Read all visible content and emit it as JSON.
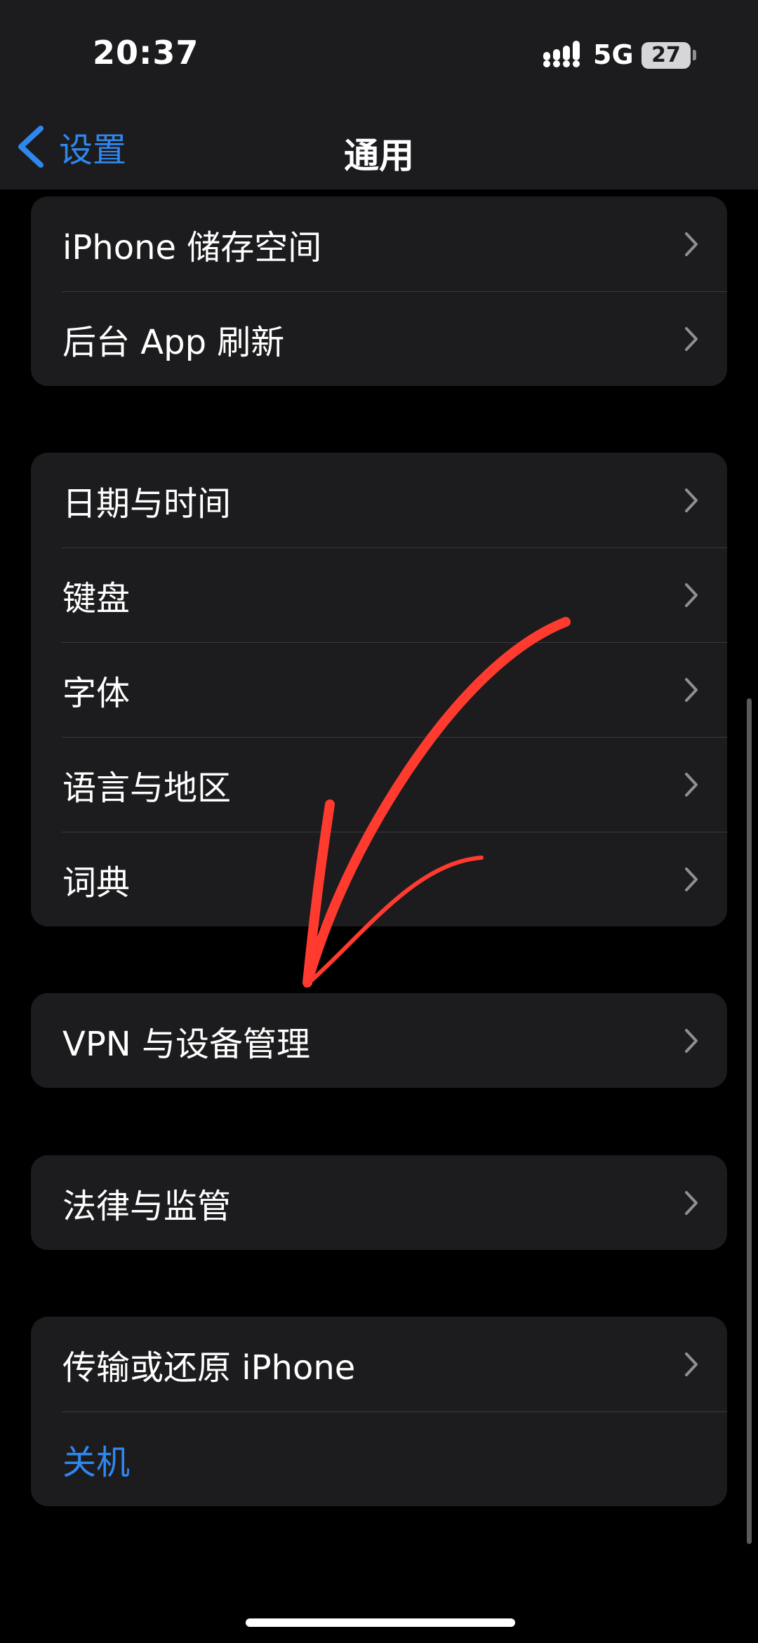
{
  "status_bar": {
    "time": "20:37",
    "network": "5G",
    "battery": "27"
  },
  "nav": {
    "back_label": "设置",
    "title": "通用"
  },
  "groups": [
    {
      "items": [
        {
          "label": "iPhone 储存空间"
        },
        {
          "label": "后台 App 刷新"
        }
      ]
    },
    {
      "items": [
        {
          "label": "日期与时间"
        },
        {
          "label": "键盘"
        },
        {
          "label": "字体"
        },
        {
          "label": "语言与地区"
        },
        {
          "label": "词典"
        }
      ]
    },
    {
      "items": [
        {
          "label": "VPN 与设备管理"
        }
      ]
    },
    {
      "items": [
        {
          "label": "法律与监管"
        }
      ]
    },
    {
      "items": [
        {
          "label": "传输或还原 iPhone"
        },
        {
          "label": "关机"
        }
      ]
    }
  ],
  "colors": {
    "accent": "#2f87ee",
    "background": "#000000",
    "cell": "#1c1c1e",
    "annotation": "#ff3b30"
  },
  "icons": [
    "back-chevron-icon",
    "chevron-right-icon",
    "cellular-signal-icon",
    "battery-icon"
  ]
}
